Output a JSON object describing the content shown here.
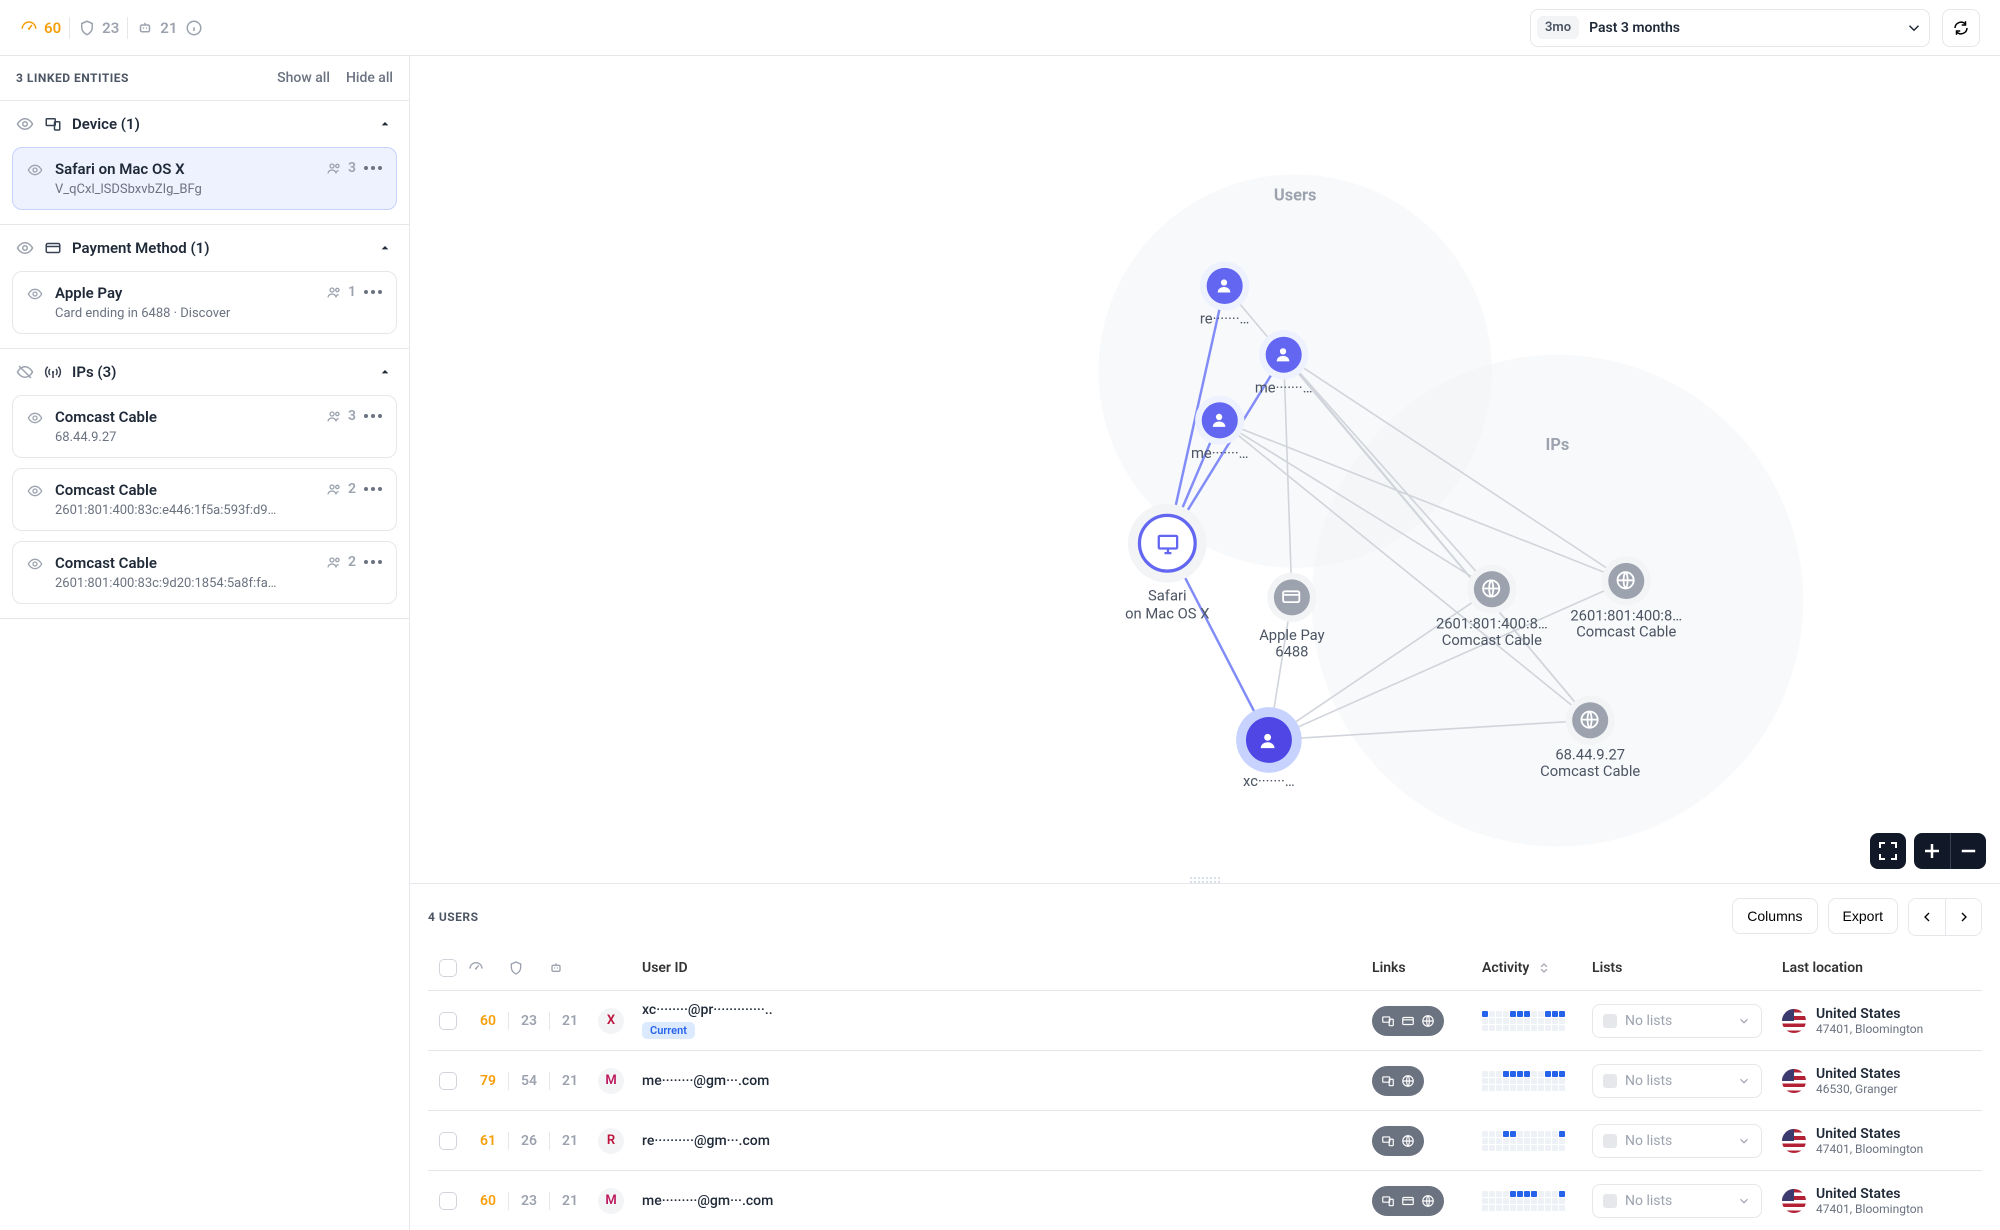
{
  "topbar": {
    "score_orange": "60",
    "score_shield": "23",
    "score_bot": "21",
    "range_chip": "3mo",
    "range_label": "Past 3 months"
  },
  "sidebar": {
    "title": "3 LINKED ENTITIES",
    "show_all": "Show all",
    "hide_all": "Hide all",
    "groups": {
      "device": {
        "title": "Device (1)",
        "items": [
          {
            "title": "Safari on Mac OS X",
            "sub": "V_qCxl_lSDSbxvbZIg_BFg",
            "count": "3",
            "selected": true
          }
        ]
      },
      "payment": {
        "title": "Payment Method (1)",
        "items": [
          {
            "title": "Apple Pay",
            "sub": "Card ending in 6488 · Discover",
            "count": "1"
          }
        ]
      },
      "ips": {
        "title": "IPs (3)",
        "items": [
          {
            "title": "Comcast Cable",
            "sub": "68.44.9.27",
            "count": "3"
          },
          {
            "title": "Comcast Cable",
            "sub": "2601:801:400:83c:e446:1f5a:593f:d9…",
            "count": "2"
          },
          {
            "title": "Comcast Cable",
            "sub": "2601:801:400:83c:9d20:1854:5a8f:fa…",
            "count": "2"
          }
        ]
      }
    }
  },
  "graph": {
    "clusters": {
      "users": "Users",
      "ips": "IPs"
    },
    "nodes": {
      "safari": {
        "l1": "Safari",
        "l2": "on Mac OS X"
      },
      "applepay": {
        "l1": "Apple Pay",
        "l2": "6488"
      },
      "ip1": {
        "l1": "2601:801:400:8…",
        "l2": "Comcast Cable"
      },
      "ip2": {
        "l1": "2601:801:400:8…",
        "l2": "Comcast Cable"
      },
      "ip3": {
        "l1": "68.44.9.27",
        "l2": "Comcast Cable"
      },
      "u1": "re·······…",
      "u2": "me·······…",
      "u3": "me·······…",
      "u4": "xc·······…"
    }
  },
  "users": {
    "count_label": "4 USERS",
    "columns_btn": "Columns",
    "export_btn": "Export",
    "headers": {
      "user_id": "User ID",
      "links": "Links",
      "activity": "Activity",
      "lists": "Lists",
      "last_location": "Last location"
    },
    "no_lists": "No lists",
    "current_badge": "Current",
    "rows": [
      {
        "s1": "60",
        "s2": "23",
        "s3": "21",
        "av": "X",
        "avClass": "av-x",
        "uid": "xc········@pr·············..",
        "current": true,
        "links": [
          "device",
          "card",
          "globe"
        ],
        "loc_c": "United States",
        "loc_s": "47401, Bloomington",
        "activity": [
          0,
          0,
          0,
          4,
          5,
          6,
          9,
          10,
          11
        ]
      },
      {
        "s1": "79",
        "s2": "54",
        "s3": "21",
        "av": "M",
        "avClass": "av-m",
        "uid": "me········@gm···.com",
        "links": [
          "device",
          "globe"
        ],
        "loc_c": "United States",
        "loc_s": "46530, Granger",
        "activity": [
          3,
          4,
          5,
          6,
          9,
          10,
          11
        ]
      },
      {
        "s1": "61",
        "s2": "26",
        "s3": "21",
        "av": "R",
        "avClass": "av-r",
        "uid": "re··········@gm···.com",
        "links": [
          "device",
          "globe"
        ],
        "loc_c": "United States",
        "loc_s": "47401, Bloomington",
        "activity": [
          3,
          4,
          11
        ]
      },
      {
        "s1": "60",
        "s2": "23",
        "s3": "21",
        "av": "M",
        "avClass": "av-m",
        "uid": "me·········@gm···.com",
        "links": [
          "device",
          "card",
          "globe"
        ],
        "loc_c": "United States",
        "loc_s": "47401, Bloomington",
        "activity": [
          4,
          5,
          6,
          7,
          11
        ]
      }
    ]
  }
}
